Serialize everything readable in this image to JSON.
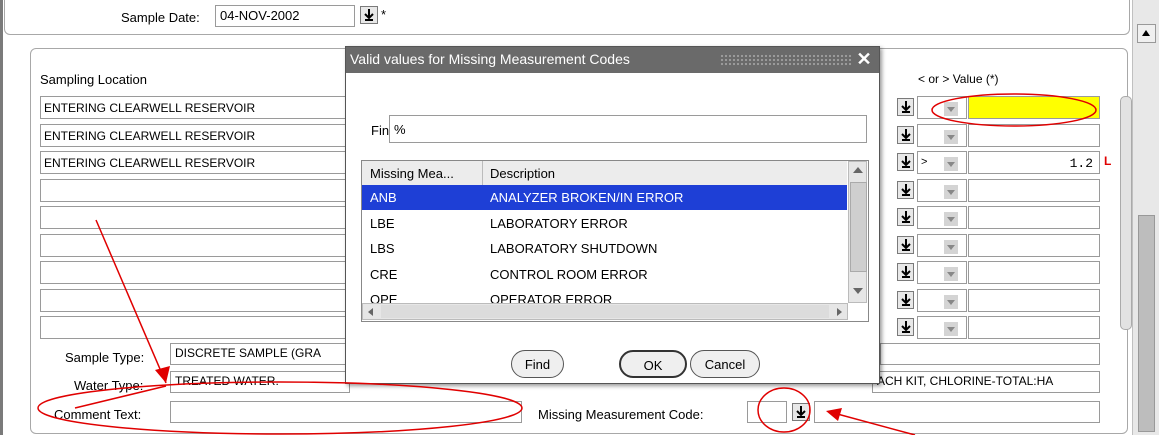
{
  "header": {
    "sample_date_label": "Sample Date:",
    "sample_date_value": "04-NOV-2002",
    "required_marker": "*"
  },
  "grid": {
    "location_header": "Sampling Location",
    "value_header": "< or >  Value (*)",
    "rows": [
      {
        "location": "ENTERING CLEARWELL RESERVOIR",
        "operator": "",
        "value": "",
        "flag": ""
      },
      {
        "location": "ENTERING CLEARWELL RESERVOIR",
        "operator": "",
        "value": "",
        "flag": ""
      },
      {
        "location": "ENTERING CLEARWELL RESERVOIR",
        "operator": ">",
        "value": "1.2",
        "flag": "L"
      },
      {
        "location": "",
        "operator": "",
        "value": "",
        "flag": ""
      },
      {
        "location": "",
        "operator": "",
        "value": "",
        "flag": ""
      },
      {
        "location": "",
        "operator": "",
        "value": "",
        "flag": ""
      },
      {
        "location": "",
        "operator": "",
        "value": "",
        "flag": ""
      },
      {
        "location": "",
        "operator": "",
        "value": "",
        "flag": ""
      },
      {
        "location": "",
        "operator": "",
        "value": "",
        "flag": ""
      }
    ]
  },
  "details": {
    "sample_type_label": "Sample Type:",
    "sample_type_value": "DISCRETE SAMPLE (GRA",
    "water_type_label": "Water Type:",
    "water_type_value": "TREATED WATER.",
    "water_type_right": "ACH KIT, CHLORINE-TOTAL:HA",
    "comment_label": "Comment Text:",
    "comment_value": "",
    "missing_code_label": "Missing Measurement Code:",
    "missing_code_value": ""
  },
  "dialog": {
    "title": "Valid values for Missing Measurement Codes",
    "close": "✕",
    "find_label": "Find",
    "find_value": "%",
    "columns": [
      "Missing Mea...",
      "Description"
    ],
    "items": [
      {
        "code": "ANB",
        "description": "ANALYZER BROKEN/IN ERROR"
      },
      {
        "code": "LBE",
        "description": "LABORATORY ERROR"
      },
      {
        "code": "LBS",
        "description": "LABORATORY SHUTDOWN"
      },
      {
        "code": "CRE",
        "description": "CONTROL ROOM ERROR"
      },
      {
        "code": "OPE",
        "description": "OPERATOR ERROR"
      }
    ],
    "buttons": {
      "find": "Find",
      "ok": "OK",
      "cancel": "Cancel"
    }
  },
  "colors": {
    "selected_row": "#1e3fd6",
    "highlight_field": "#ffff00",
    "annotation": "#e00000",
    "title_bar": "#6a6a6a"
  }
}
